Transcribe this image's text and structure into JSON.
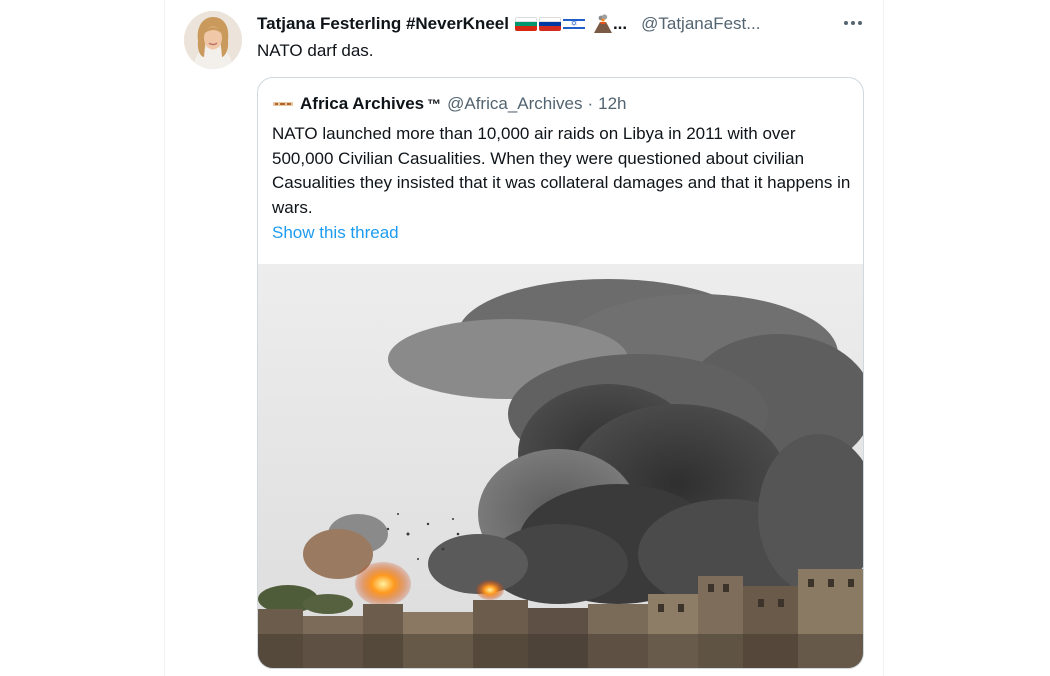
{
  "tweet": {
    "author_name": "Tatjana Festerling #NeverKneel",
    "ellipsis": "...",
    "author_handle": "@TatjanaFest...",
    "text": "NATO darf das.",
    "flags": [
      "bulgaria-flag",
      "russia-flag",
      "israel-flag",
      "volcano-icon"
    ]
  },
  "quote": {
    "author_name": "Africa Archives",
    "trademark": "™",
    "handle": "@Africa_Archives",
    "separator": "·",
    "time": "12h",
    "text": "NATO launched more than 10,000 air raids on Libya in 2011 with over 500,000 Civilian Casualities. When they were questioned about civilian Casualities they insisted that it was collateral damages and that it happens in wars.",
    "show_thread": "Show this thread"
  },
  "colors": {
    "text": "#0f1419",
    "secondary": "#536471",
    "link": "#1d9bf0",
    "border": "#cfd9de"
  }
}
